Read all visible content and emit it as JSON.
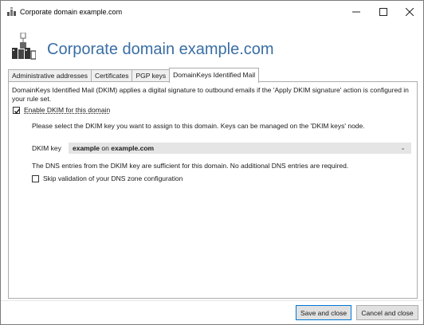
{
  "window": {
    "title": "Corporate domain example.com",
    "minimize_icon": "minimize-icon",
    "maximize_icon": "maximize-icon",
    "close_icon": "close-icon"
  },
  "header": {
    "title": "Corporate domain example.com",
    "icon": "domain-server-icon"
  },
  "tabs": [
    {
      "label": "Administrative addresses",
      "active": false
    },
    {
      "label": "Certificates",
      "active": false
    },
    {
      "label": "PGP keys",
      "active": false
    },
    {
      "label": "DomainKeys Identified Mail",
      "active": true
    }
  ],
  "dkim": {
    "description": "DomainKeys Identified Mail (DKIM) applies a digital signature to outbound emails if the 'Apply DKIM signature' action is configured in your rule set.",
    "enable_label": "Enable DKIM for this domain",
    "enable_checked": true,
    "select_hint": "Please select the DKIM key you want to assign to this domain. Keys can be managed on the 'DKIM keys' node.",
    "key_label": "DKIM key",
    "key_value_name": "example",
    "key_value_on": " on ",
    "key_value_domain": "example.com",
    "dns_info": "The DNS entries from the DKIM key are sufficient for this domain. No additional DNS entries are required.",
    "skip_label": "Skip validation of your DNS zone configuration",
    "skip_checked": false
  },
  "buttons": {
    "save_close": "Save and close",
    "cancel_close": "Cancel and close"
  }
}
